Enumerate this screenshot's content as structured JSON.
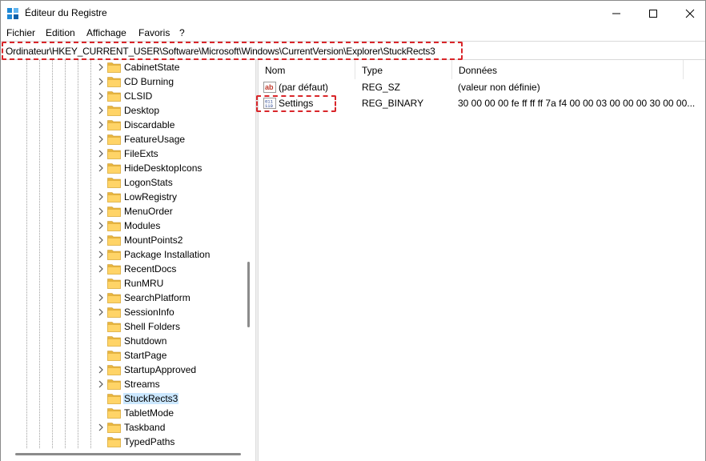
{
  "window": {
    "title": "Éditeur du Registre",
    "accent_color": "#d9262a"
  },
  "menu": {
    "items": [
      "Fichier",
      "Edition",
      "Affichage",
      "Favoris",
      "?"
    ]
  },
  "address": {
    "path": "Ordinateur\\HKEY_CURRENT_USER\\Software\\Microsoft\\Windows\\CurrentVersion\\Explorer\\StuckRects3"
  },
  "tree": {
    "items": [
      {
        "label": "CabinetState",
        "expandable": true
      },
      {
        "label": "CD Burning",
        "expandable": true
      },
      {
        "label": "CLSID",
        "expandable": true
      },
      {
        "label": "Desktop",
        "expandable": true
      },
      {
        "label": "Discardable",
        "expandable": true
      },
      {
        "label": "FeatureUsage",
        "expandable": true
      },
      {
        "label": "FileExts",
        "expandable": true
      },
      {
        "label": "HideDesktopIcons",
        "expandable": true
      },
      {
        "label": "LogonStats",
        "expandable": false
      },
      {
        "label": "LowRegistry",
        "expandable": true
      },
      {
        "label": "MenuOrder",
        "expandable": true
      },
      {
        "label": "Modules",
        "expandable": true
      },
      {
        "label": "MountPoints2",
        "expandable": true
      },
      {
        "label": "Package Installation",
        "expandable": true
      },
      {
        "label": "RecentDocs",
        "expandable": true
      },
      {
        "label": "RunMRU",
        "expandable": false
      },
      {
        "label": "SearchPlatform",
        "expandable": true
      },
      {
        "label": "SessionInfo",
        "expandable": true
      },
      {
        "label": "Shell Folders",
        "expandable": false
      },
      {
        "label": "Shutdown",
        "expandable": false
      },
      {
        "label": "StartPage",
        "expandable": false
      },
      {
        "label": "StartupApproved",
        "expandable": true
      },
      {
        "label": "Streams",
        "expandable": true
      },
      {
        "label": "StuckRects3",
        "expandable": false,
        "selected": true
      },
      {
        "label": "TabletMode",
        "expandable": false
      },
      {
        "label": "Taskband",
        "expandable": true
      },
      {
        "label": "TypedPaths",
        "expandable": false
      }
    ]
  },
  "list": {
    "columns": {
      "name": "Nom",
      "type": "Type",
      "data": "Données"
    },
    "rows": [
      {
        "name": "(par défaut)",
        "type": "REG_SZ",
        "data": "(valeur non définie)",
        "icon": "string-value-icon"
      },
      {
        "name": "Settings",
        "type": "REG_BINARY",
        "data": "30 00 00 00 fe ff ff ff 7a f4 00 00 03 00 00 00 30 00 00...",
        "icon": "binary-value-icon"
      }
    ]
  }
}
